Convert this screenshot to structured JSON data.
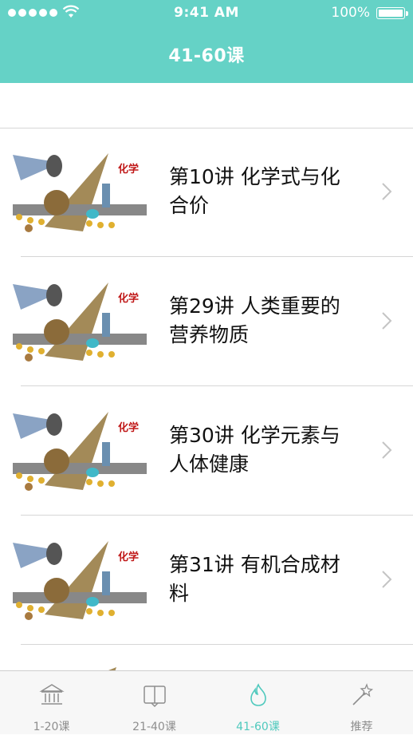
{
  "status_bar": {
    "time": "9:41 AM",
    "battery": "100%"
  },
  "nav": {
    "title": "41-60课"
  },
  "lessons": [
    {
      "title": "第10讲 化学式与化合价",
      "thumb_text": "化学"
    },
    {
      "title": "第29讲 人类重要的营养物质",
      "thumb_text": "化学"
    },
    {
      "title": "第30讲 化学元素与人体健康",
      "thumb_text": "化学"
    },
    {
      "title": "第31讲 有机合成材料",
      "thumb_text": "化学"
    }
  ],
  "tabs": [
    {
      "label": "1-20课",
      "icon": "museum-icon",
      "active": false
    },
    {
      "label": "21-40课",
      "icon": "book-icon",
      "active": false
    },
    {
      "label": "41-60课",
      "icon": "flame-icon",
      "active": true
    },
    {
      "label": "推荐",
      "icon": "magic-wand-icon",
      "active": false
    }
  ],
  "colors": {
    "accent": "#65d2c6",
    "tab_active": "#4fc9bd",
    "tab_inactive": "#8e8e8e"
  }
}
